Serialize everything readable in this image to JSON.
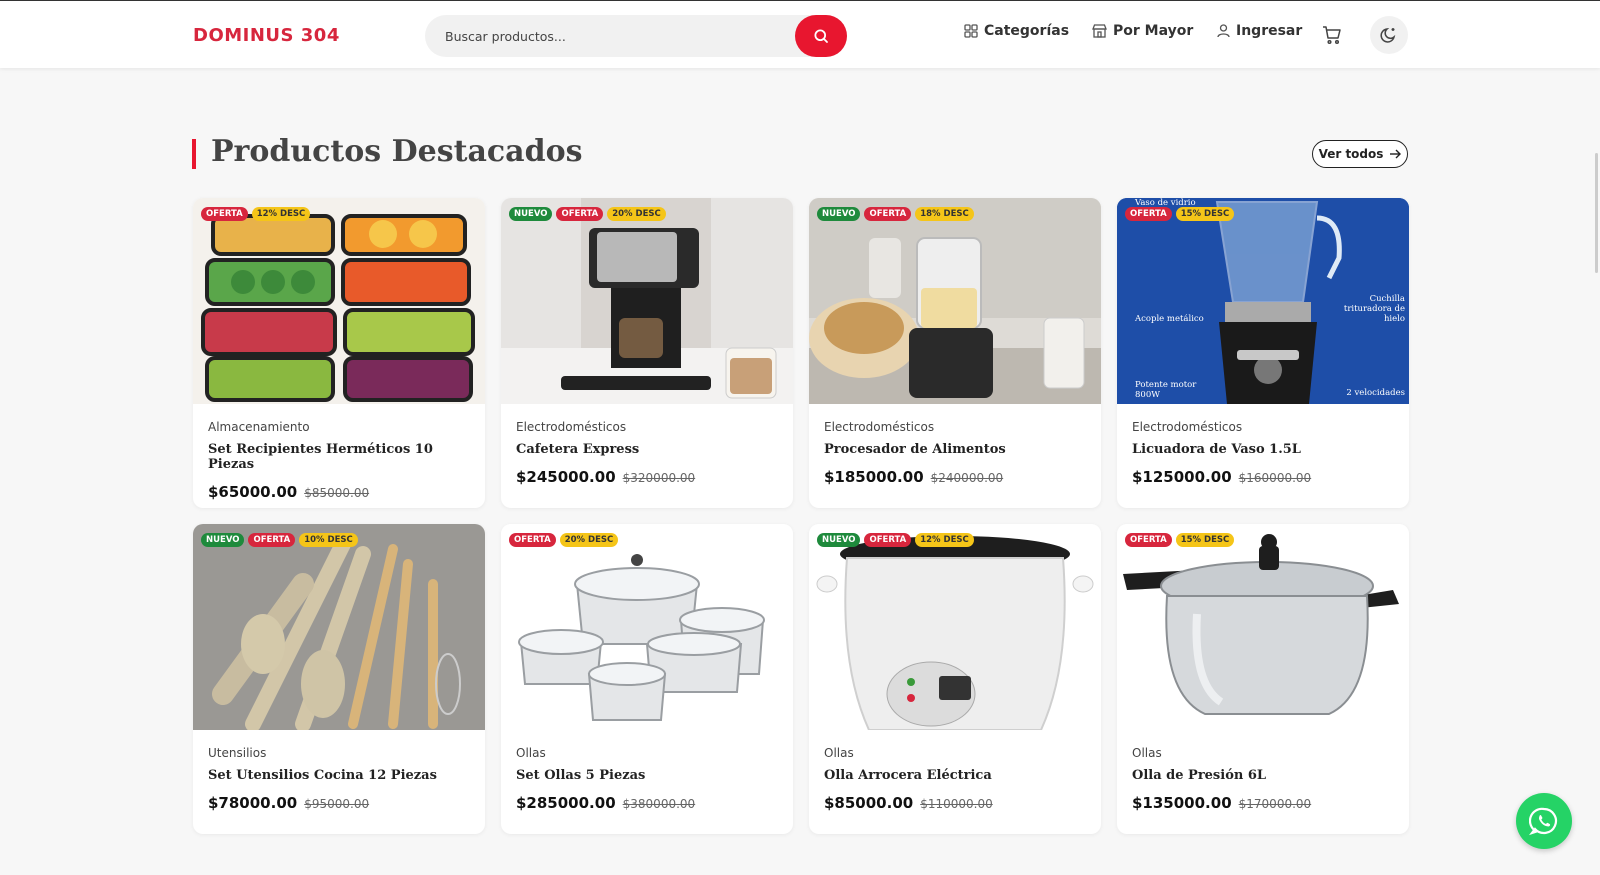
{
  "header": {
    "logo": "DOMINUS 304",
    "search_placeholder": "Buscar productos...",
    "nav": {
      "categories": "Categorías",
      "wholesale": "Por Mayor",
      "login": "Ingresar"
    }
  },
  "section": {
    "title": "Productos Destacados",
    "see_all": "Ver todos"
  },
  "products": [
    {
      "category": "Almacenamiento",
      "name": "Set Recipientes Herméticos 10 Piezas",
      "price": "$65000.00",
      "old_price": "$85000.00",
      "badges": [
        "OFERTA",
        "12% DESC"
      ],
      "image": "food-containers"
    },
    {
      "category": "Electrodomésticos",
      "name": "Cafetera Express",
      "price": "$245000.00",
      "old_price": "$320000.00",
      "badges": [
        "NUEVO",
        "OFERTA",
        "20% DESC"
      ],
      "image": "espresso-machine"
    },
    {
      "category": "Electrodomésticos",
      "name": "Procesador de Alimentos",
      "price": "$185000.00",
      "old_price": "$240000.00",
      "badges": [
        "NUEVO",
        "OFERTA",
        "18% DESC"
      ],
      "image": "food-processor"
    },
    {
      "category": "Electrodomésticos",
      "name": "Licuadora de Vaso 1.5L",
      "price": "$125000.00",
      "old_price": "$160000.00",
      "badges": [
        "OFERTA",
        "15% DESC"
      ],
      "image": "blender"
    },
    {
      "category": "Utensilios",
      "name": "Set Utensilios Cocina 12 Piezas",
      "price": "$78000.00",
      "old_price": "$95000.00",
      "badges": [
        "NUEVO",
        "OFERTA",
        "10% DESC"
      ],
      "image": "kitchen-utensils"
    },
    {
      "category": "Ollas",
      "name": "Set Ollas 5 Piezas",
      "price": "$285000.00",
      "old_price": "$380000.00",
      "badges": [
        "OFERTA",
        "20% DESC"
      ],
      "image": "pot-set"
    },
    {
      "category": "Ollas",
      "name": "Olla Arrocera Eléctrica",
      "price": "$85000.00",
      "old_price": "$110000.00",
      "badges": [
        "NUEVO",
        "OFERTA",
        "12% DESC"
      ],
      "image": "rice-cooker"
    },
    {
      "category": "Ollas",
      "name": "Olla de Presión 6L",
      "price": "$135000.00",
      "old_price": "$170000.00",
      "badges": [
        "OFERTA",
        "15% DESC"
      ],
      "image": "pressure-cooker"
    }
  ],
  "blender_image_text": {
    "top": "Vaso de vidrio de 1.5L",
    "left": "Acople metálico",
    "right": "Cuchilla trituradora de hielo",
    "motor": "Potente motor 800W",
    "speeds": "2 velocidades"
  },
  "colors": {
    "accent": "#e8162f",
    "nuevo": "#1e8a3c",
    "oferta": "#d7263d",
    "desc": "#f5c518",
    "whatsapp": "#25d366"
  }
}
